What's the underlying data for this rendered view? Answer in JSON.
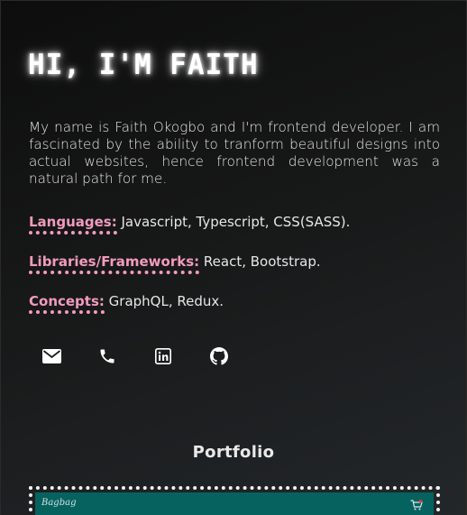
{
  "hero": {
    "title": "HI, I'M FAITH"
  },
  "intro": {
    "text": "My name is Faith Okogbo and I'm frontend developer. I am fascinated by the ability to tranform beautiful designs into actual websites, hence frontend development was a natural path for me."
  },
  "skills": [
    {
      "key": "Languages:",
      "value": " Javascript, Typescript, CSS(SASS)."
    },
    {
      "key": "Libraries/Frameworks:",
      "value": " React, Bootstrap."
    },
    {
      "key": "Concepts:",
      "value": " GraphQL, Redux."
    }
  ],
  "contacts": [
    {
      "icon": "mail-icon"
    },
    {
      "icon": "phone-icon"
    },
    {
      "icon": "linkedin-icon"
    },
    {
      "icon": "github-icon"
    }
  ],
  "portfolio": {
    "title": "Portfolio",
    "project_logo": "Bagbag"
  },
  "colors": {
    "accent": "#f29bbd",
    "preview_bg": "#06625f",
    "text": "#e4e4e4"
  }
}
